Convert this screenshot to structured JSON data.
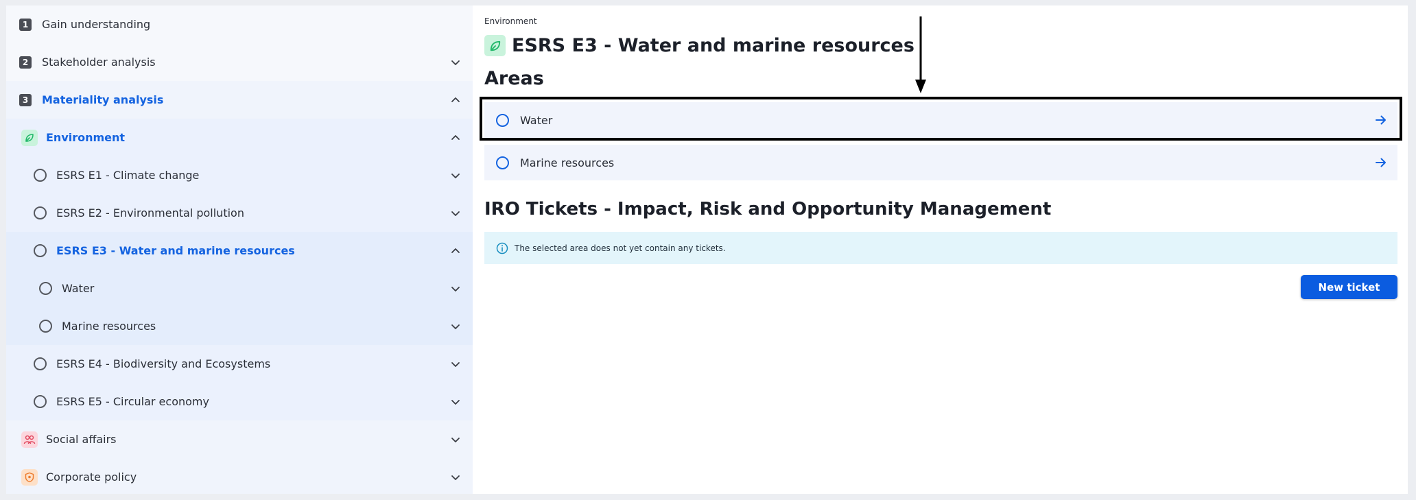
{
  "sidebar": {
    "steps": [
      {
        "number": "1",
        "label": "Gain understanding"
      },
      {
        "number": "2",
        "label": "Stakeholder analysis"
      },
      {
        "number": "3",
        "label": "Materiality analysis"
      }
    ],
    "environment": {
      "label": "Environment",
      "icon": "leaf-icon"
    },
    "standards": [
      {
        "label": "ESRS E1 - Climate change"
      },
      {
        "label": "ESRS E2 - Environmental pollution"
      },
      {
        "label": "ESRS E3 - Water and marine resources"
      },
      {
        "label": "ESRS E4 - Biodiversity and Ecosystems"
      },
      {
        "label": "ESRS E5 - Circular economy"
      }
    ],
    "e3_children": [
      {
        "label": "Water"
      },
      {
        "label": "Marine resources"
      }
    ],
    "social": {
      "label": "Social affairs",
      "icon": "people-icon"
    },
    "corporate": {
      "label": "Corporate policy",
      "icon": "shield-icon"
    }
  },
  "main": {
    "breadcrumb": "Environment",
    "title": "ESRS E3 - Water and marine resources",
    "areas_heading": "Areas",
    "areas": [
      {
        "label": "Water"
      },
      {
        "label": "Marine resources"
      }
    ],
    "tickets_heading": "IRO Tickets - Impact, Risk and Opportunity Management",
    "info_message": "The selected area does not yet contain any tickets.",
    "new_ticket_label": "New ticket"
  },
  "colors": {
    "accent": "#1463e0",
    "button": "#0b5ce0",
    "environment": "#3ccf7f",
    "social": "#e85a7a",
    "corporate": "#f08a3c",
    "info_bg": "#e3f5fb"
  }
}
